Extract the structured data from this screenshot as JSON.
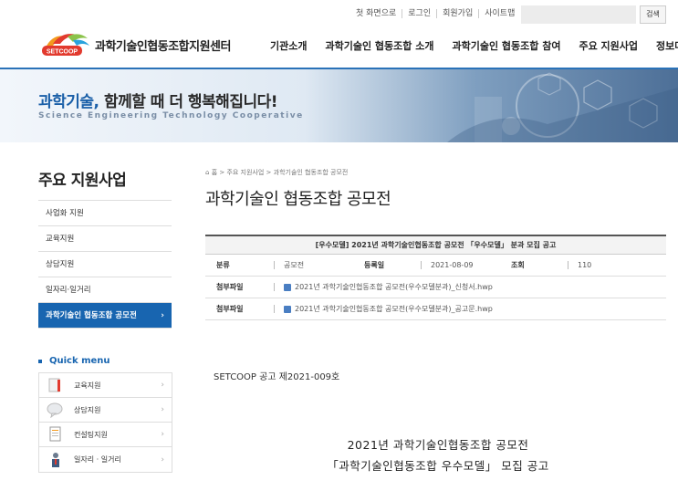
{
  "util": {
    "links": [
      "첫 화면으로",
      "로그인",
      "회원가입",
      "사이트맵"
    ],
    "search_placeholder": "",
    "search_button": "검색"
  },
  "header": {
    "logo_mark": "SETCOOP",
    "logo_text": "과학기술인협동조합지원센터",
    "gnb": [
      "기관소개",
      "과학기술인 협동조합 소개",
      "과학기술인 협동조합 참여",
      "주요 지원사업",
      "정보마당"
    ]
  },
  "banner": {
    "title_accent": "과학기술,",
    "title_rest": " 함께할 때 더 행복해집니다!",
    "subtitle": "Science Engineering Technology Cooperative"
  },
  "sidebar": {
    "title": "주요 지원사업",
    "items": [
      {
        "label": "사업화 지원"
      },
      {
        "label": "교육지원"
      },
      {
        "label": "상담지원"
      },
      {
        "label": "일자리·일거리"
      },
      {
        "label": "과학기술인 협동조합 공모전",
        "active": true
      }
    ],
    "active_arrow": "›"
  },
  "quick_menu": {
    "title": "Quick menu",
    "items": [
      {
        "label": "교육지원",
        "icon": "book-icon"
      },
      {
        "label": "상담지원",
        "icon": "chat-icon"
      },
      {
        "label": "컨설팅지원",
        "icon": "document-icon"
      },
      {
        "label": "일자리 · 일거리",
        "icon": "person-icon"
      }
    ],
    "chevron": "›"
  },
  "main": {
    "breadcrumb": "홈 > 주요 지원사업 > 과학기술인 협동조합 공모전",
    "page_title": "과학기술인 협동조합 공모전",
    "board": {
      "subject": "[우수모델] 2021년 과학기술인협동조합 공모전 「우수모델」 분과 모집 공고",
      "category_label": "분류",
      "category_value": "공모전",
      "date_label": "등록일",
      "date_value": "2021-08-09",
      "views_label": "조회",
      "views_value": "110",
      "attachments": [
        {
          "label": "첨부파일",
          "file": "2021년 과학기술인협동조합 공모전(우수모델분과)_신청서.hwp"
        },
        {
          "label": "첨부파일",
          "file": "2021년 과학기술인협동조합 공모전(우수모델분과)_공고문.hwp"
        }
      ]
    },
    "notice_no": "SETCOOP 공고 제2021-009호",
    "body_title_1": "2021년 과학기술인협동조합 공모전",
    "body_title_2": "「과학기술인협동조합 우수모델」 모집 공고"
  },
  "colors": {
    "brand_blue": "#1865b0",
    "header_line": "#2a72b8",
    "logo_red": "#e23a2e",
    "logo_orange": "#f39a1e"
  }
}
